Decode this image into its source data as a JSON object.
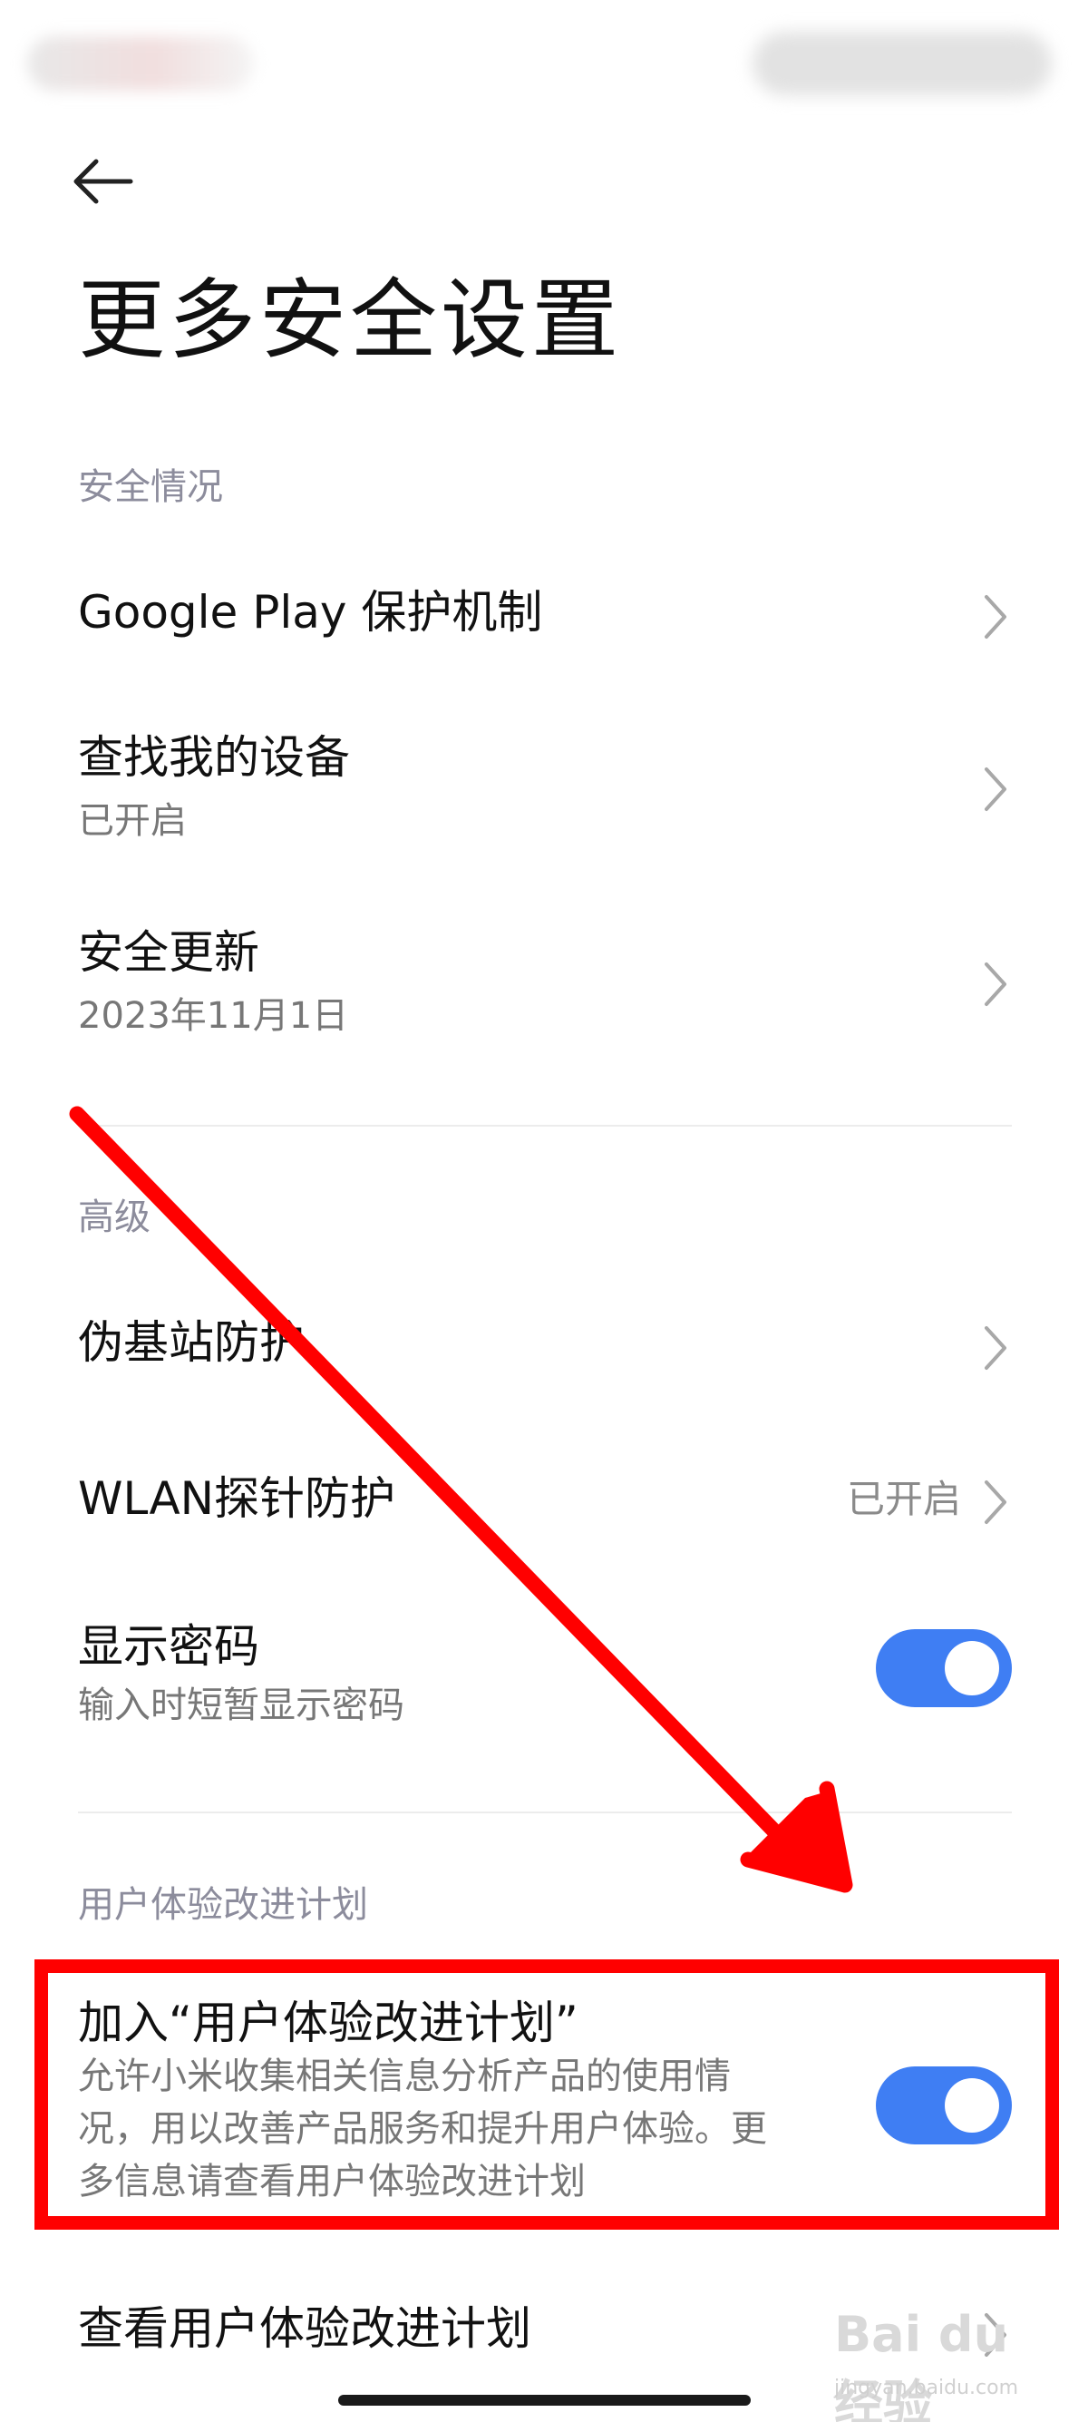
{
  "header": {
    "title": "更多安全设置"
  },
  "sections": {
    "status": {
      "label": "安全情况"
    },
    "advanced": {
      "label": "高级"
    },
    "ux_plan": {
      "label": "用户体验改进计划"
    }
  },
  "items": {
    "google_play": {
      "title": "Google Play 保护机制"
    },
    "find_device": {
      "title": "查找我的设备",
      "subtitle": "已开启"
    },
    "security_update": {
      "title": "安全更新",
      "subtitle": "2023年11月1日"
    },
    "fake_base_station": {
      "title": "伪基站防护"
    },
    "wlan_probe": {
      "title": "WLAN探针防护",
      "value": "已开启"
    },
    "show_password": {
      "title": "显示密码",
      "subtitle": "输入时短暂显示密码",
      "enabled": true
    },
    "join_ux_plan": {
      "title": "加入“用户体验改进计划”",
      "desc_lines": [
        "允许小米收集相关信息分析产品的使用情",
        "况，用以改善产品服务和提升用户体验。更",
        "多信息请查看用户体验改进计划"
      ],
      "enabled": true
    },
    "view_ux_plan": {
      "title": "查看用户体验改进计划"
    }
  },
  "watermark": {
    "text": "Bai du 经验",
    "url": "jingyan.baidu.com"
  },
  "colors": {
    "accent": "#3f7ef3",
    "annotation": "#ff0000"
  },
  "icons": {
    "back": "arrow-left-icon",
    "chevron": "chevron-right-icon"
  }
}
